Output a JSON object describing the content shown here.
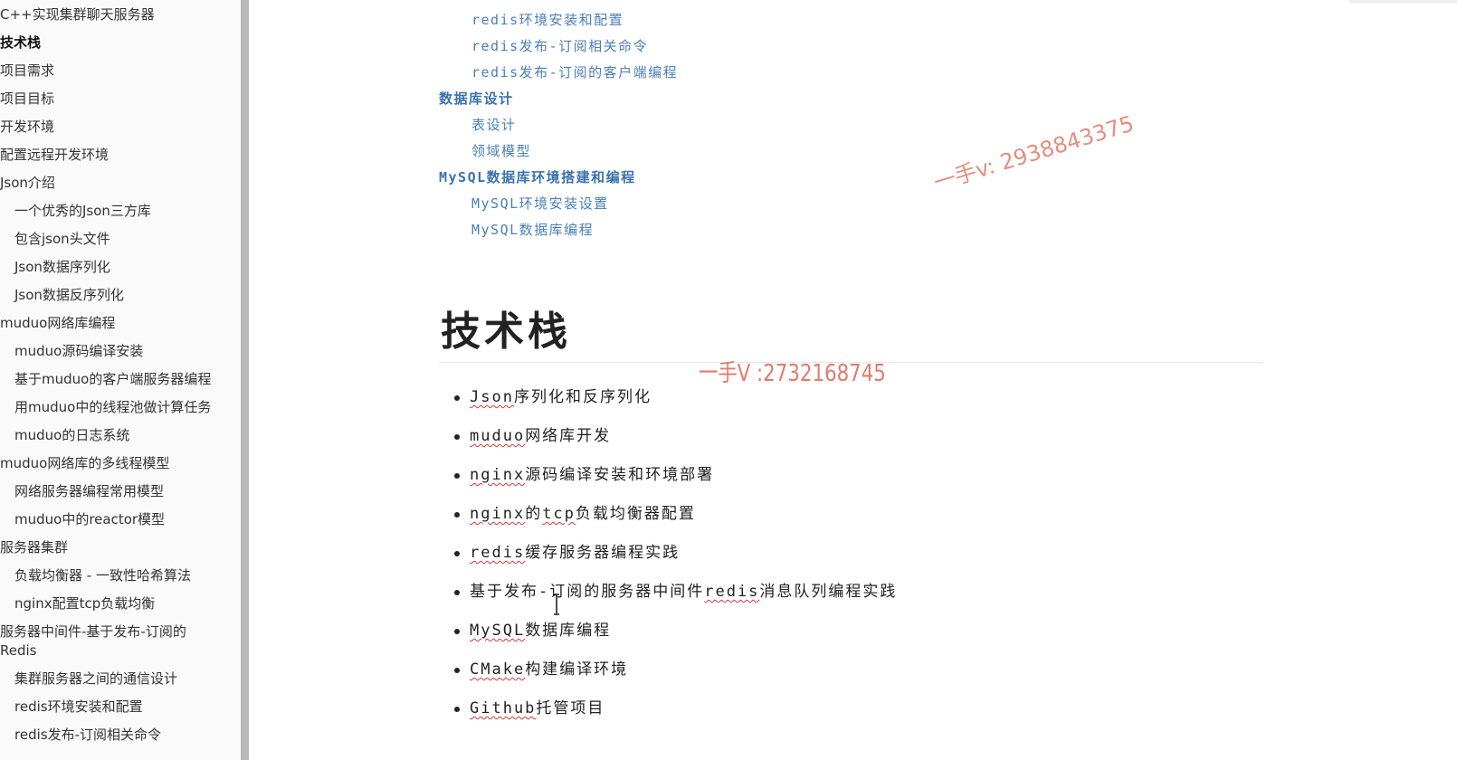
{
  "sidebar": {
    "items": [
      {
        "label": "C++实现集群聊天服务器",
        "level": 1
      },
      {
        "label": "技术栈",
        "level": 1,
        "active": true
      },
      {
        "label": "项目需求",
        "level": 1
      },
      {
        "label": "项目目标",
        "level": 1
      },
      {
        "label": "开发环境",
        "level": 1
      },
      {
        "label": "配置远程开发环境",
        "level": 1
      },
      {
        "label": "Json介绍",
        "level": 1
      },
      {
        "label": "一个优秀的Json三方库",
        "level": 2
      },
      {
        "label": "包含json头文件",
        "level": 2
      },
      {
        "label": "Json数据序列化",
        "level": 2
      },
      {
        "label": "Json数据反序列化",
        "level": 2
      },
      {
        "label": "muduo网络库编程",
        "level": 1
      },
      {
        "label": "muduo源码编译安装",
        "level": 2
      },
      {
        "label": "基于muduo的客户端服务器编程",
        "level": 2
      },
      {
        "label": "用muduo中的线程池做计算任务",
        "level": 2
      },
      {
        "label": "muduo的日志系统",
        "level": 2
      },
      {
        "label": "muduo网络库的多线程模型",
        "level": 1
      },
      {
        "label": "网络服务器编程常用模型",
        "level": 2
      },
      {
        "label": "muduo中的reactor模型",
        "level": 2
      },
      {
        "label": "服务器集群",
        "level": 1
      },
      {
        "label": "负载均衡器 - 一致性哈希算法",
        "level": 2
      },
      {
        "label": "nginx配置tcp负载均衡",
        "level": 2
      },
      {
        "label": "服务器中间件-基于发布-订阅的Redis",
        "level": 1
      },
      {
        "label": "集群服务器之间的通信设计",
        "level": 2
      },
      {
        "label": "redis环境安装和配置",
        "level": 2
      },
      {
        "label": "redis发布-订阅相关命令",
        "level": 2
      }
    ]
  },
  "main": {
    "toc": [
      {
        "label": "redis环境安装和配置",
        "level": 2
      },
      {
        "label": "redis发布-订阅相关命令",
        "level": 2
      },
      {
        "label": "redis发布-订阅的客户端编程",
        "level": 2
      },
      {
        "label": "数据库设计",
        "level": 1
      },
      {
        "label": "表设计",
        "level": 2
      },
      {
        "label": "领域模型",
        "level": 2
      },
      {
        "label": "MySQL数据库环境搭建和编程",
        "level": 1
      },
      {
        "label": "MySQL环境安装设置",
        "level": 2
      },
      {
        "label": "MySQL数据库编程",
        "level": 2
      }
    ],
    "section_title": "技术栈",
    "tech_stack": [
      {
        "prefix": "",
        "term": "Json",
        "suffix": "序列化和反序列化"
      },
      {
        "prefix": "",
        "term": "muduo",
        "suffix": "网络库开发"
      },
      {
        "prefix": "",
        "term": "nginx",
        "suffix": "源码编译安装和环境部署"
      },
      {
        "prefix": "",
        "term": "nginx",
        "suffix": "的tcp负载均衡器配置",
        "term2": "tcp"
      },
      {
        "prefix": "",
        "term": "redis",
        "suffix": "缓存服务器编程实践"
      },
      {
        "prefix": "基于发布-订阅的服务器中间件",
        "term": "redis",
        "suffix": "消息队列编程实践"
      },
      {
        "prefix": "",
        "term": "MySQL",
        "suffix": "数据库编程"
      },
      {
        "prefix": "",
        "term": "CMake",
        "suffix": "构建编译环境"
      },
      {
        "prefix": "",
        "term": "Github",
        "suffix": "托管项目"
      }
    ]
  },
  "watermarks": {
    "wm1": "一手v: 2938843375",
    "wm2": "一手V :2732168745"
  },
  "colors": {
    "toc_link": "#4a7fb8",
    "watermark": "#e07b6c",
    "spellcheck": "#d23a3a"
  }
}
